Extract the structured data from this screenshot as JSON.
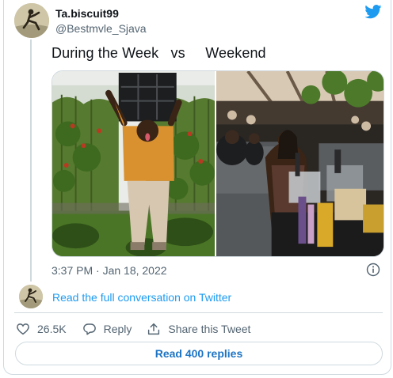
{
  "author": {
    "display_name": "Ta.biscuit99",
    "handle": "@Bestmvle_Sjava"
  },
  "tweet": {
    "text": "During the Week   vs     Weekend",
    "timestamp": "3:37 PM · Jan 18, 2022"
  },
  "media": {
    "photo_left": "farm-worker-photo",
    "photo_right": "lounge-party-photo"
  },
  "conversation": {
    "link_text": "Read the full conversation on Twitter"
  },
  "actions": {
    "like_count": "26.5K",
    "reply_label": "Reply",
    "share_label": "Share this Tweet"
  },
  "read_replies_label": "Read 400 replies",
  "colors": {
    "brand": "#1d9bf0",
    "text": "#0f1419",
    "secondary": "#536471",
    "border": "#cfd9de"
  }
}
